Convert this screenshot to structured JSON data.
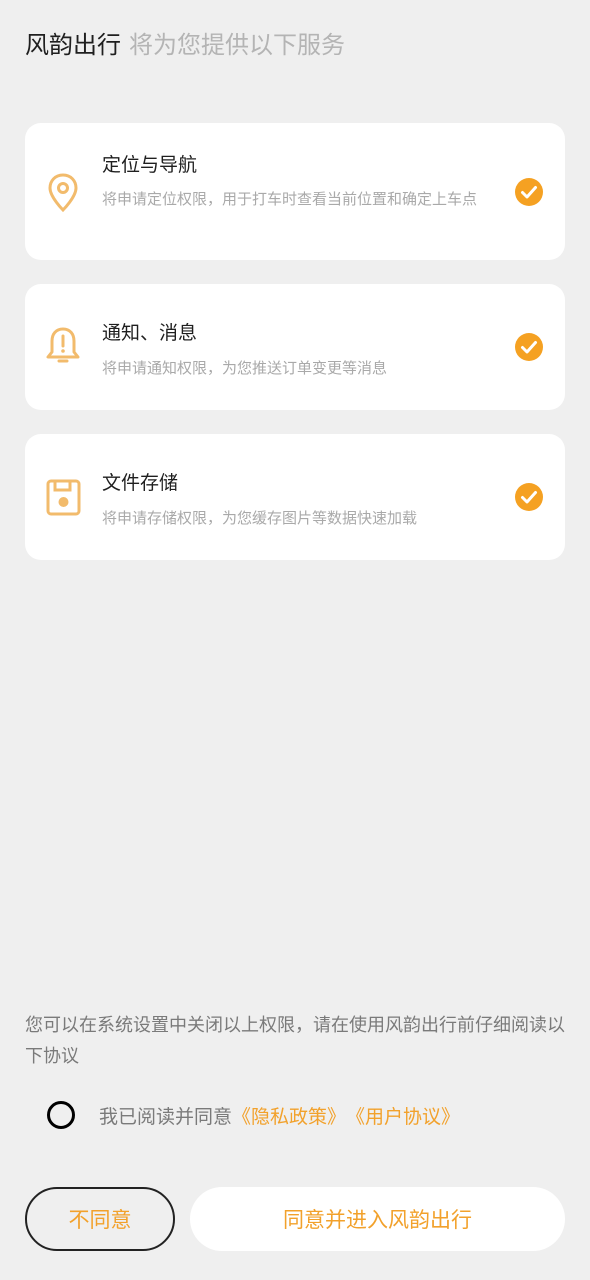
{
  "header": {
    "app_name": "风韵出行",
    "subtitle": "将为您提供以下服务"
  },
  "permissions": [
    {
      "icon": "location-pin-icon",
      "title": "定位与导航",
      "description": "将申请定位权限，用于打车时查看当前位置和确定上车点",
      "checked": true
    },
    {
      "icon": "bell-alert-icon",
      "title": "通知、消息",
      "description": "将申请通知权限，为您推送订单变更等消息",
      "checked": true
    },
    {
      "icon": "floppy-disk-icon",
      "title": "文件存储",
      "description": "将申请存储权限，为您缓存图片等数据快速加载",
      "checked": true
    }
  ],
  "notice": "您可以在系统设置中关闭以上权限，请在使用风韵出行前仔细阅读以下协议",
  "agreement": {
    "prefix": "我已阅读并同意",
    "privacy_link": "《隐私政策》",
    "user_link": "《用户协议》",
    "checked": false
  },
  "buttons": {
    "disagree": "不同意",
    "agree": "同意并进入风韵出行"
  },
  "colors": {
    "accent": "#f5a122",
    "icon": "#f2bb6c",
    "background": "#efefef"
  }
}
